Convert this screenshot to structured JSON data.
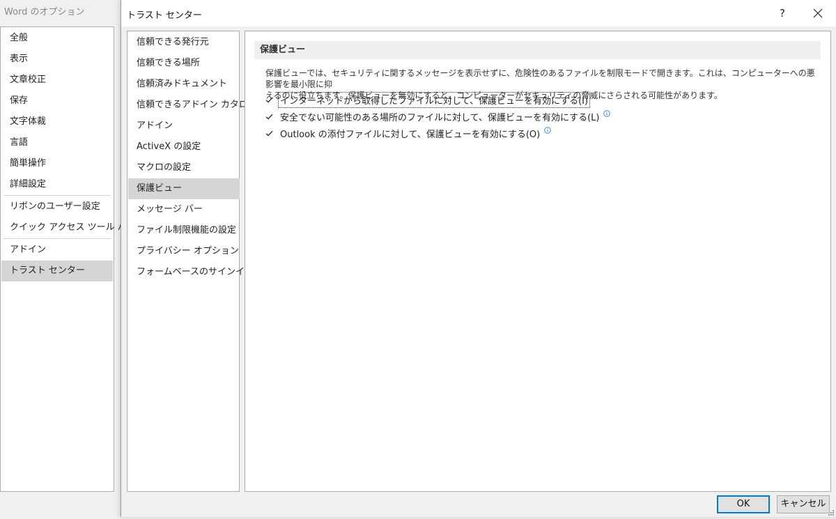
{
  "background_window": {
    "title": "Word のオプション",
    "sidebar_items": [
      "全般",
      "表示",
      "文章校正",
      "保存",
      "文字体裁",
      "言語",
      "簡単操作",
      "詳細設定",
      "リボンのユーザー設定",
      "クイック アクセス ツール バー",
      "アドイン",
      "トラスト センター"
    ],
    "active_item": "トラスト センター"
  },
  "dialog": {
    "title": "トラスト センター",
    "help_label": "?",
    "nav_items": [
      "信頼できる発行元",
      "信頼できる場所",
      "信頼済みドキュメント",
      "信頼できるアドイン カタログ",
      "アドイン",
      "ActiveX の設定",
      "マクロの設定",
      "保護ビュー",
      "メッセージ バー",
      "ファイル制限機能の設定",
      "プライバシー オプション",
      "フォームベースのサインイン"
    ],
    "active_nav": "保護ビュー",
    "section": {
      "header": "保護ビュー",
      "description_line1": "保護ビューでは、セキュリティに関するメッセージを表示せずに、危険性のあるファイルを制限モードで開きます。これは、コンピューターへの悪影響を最小限に抑",
      "description_line2": "えるのに役立ちます。保護ビューを無効にすると、コンピューターがセキュリティの脅威にさらされる可能性があります。",
      "options": [
        {
          "label": "インターネットから取得したファイルに対して、保護ビューを有効にする(I)",
          "checked": true,
          "focused": true,
          "info": false
        },
        {
          "label": "安全でない可能性のある場所のファイルに対して、保護ビューを有効にする(L)",
          "checked": true,
          "focused": false,
          "info": true
        },
        {
          "label": "Outlook の添付ファイルに対して、保護ビューを有効にする(O)",
          "checked": true,
          "focused": false,
          "info": true
        }
      ]
    },
    "ok_label": "OK",
    "cancel_label": "キャンセル"
  },
  "colors": {
    "accent": "#0078d7",
    "selected_bg": "#d5d5d5",
    "info_icon": "#2b7cd3"
  },
  "icons": {
    "close": "close-icon",
    "checkbox": "checkmark-icon",
    "info": "info-icon",
    "grip": "resize-grip-icon"
  }
}
